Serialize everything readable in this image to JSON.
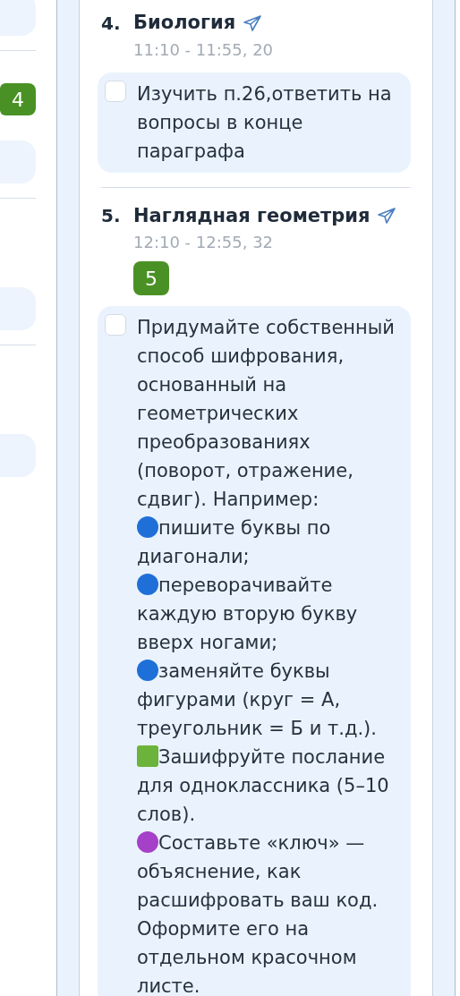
{
  "left_panel": [
    {
      "kind": "card"
    },
    {
      "kind": "grade",
      "text": "4"
    },
    {
      "kind": "card"
    },
    {
      "kind": "card"
    },
    {
      "kind": "card"
    }
  ],
  "lessons": [
    {
      "number": "4.",
      "subject": "Биология",
      "time": "11:10 - 11:55, 20",
      "tasks": [
        {
          "checked": false,
          "parts": [
            {
              "kind": "text",
              "text": "Изучить п.26,ответить на вопросы в конце параграфа"
            }
          ]
        }
      ]
    },
    {
      "number": "5.",
      "subject": "Наглядная геометрия",
      "time": "12:10 - 12:55, 32",
      "grade": "5",
      "tasks": [
        {
          "checked": false,
          "parts": [
            {
              "kind": "text",
              "text": "Придумайте собственный способ шифрования, основанный на геометрических преобразованиях (поворот, отражение, сдвиг). Например: "
            },
            {
              "kind": "dot",
              "color": "#1f6fd8"
            },
            {
              "kind": "text",
              "text": "пишите буквы по диагонали; "
            },
            {
              "kind": "dot",
              "color": "#1f6fd8"
            },
            {
              "kind": "text",
              "text": "переворачивайте каждую вторую букву вверх ногами; "
            },
            {
              "kind": "dot",
              "color": "#1f6fd8"
            },
            {
              "kind": "text",
              "text": "заменяйте буквы фигурами (круг = А, треугольник = Б и т.д.). "
            },
            {
              "kind": "square",
              "color": "#6bb33a"
            },
            {
              "kind": "text",
              "text": "Зашифруйте послание для одноклассника (5–10 слов). "
            },
            {
              "kind": "dot",
              "color": "#a540c8"
            },
            {
              "kind": "text",
              "text": "Составьте «ключ» — объяснение, как расшифровать ваш код. Оформите его на отдельном красочном листе."
            }
          ]
        }
      ]
    }
  ]
}
